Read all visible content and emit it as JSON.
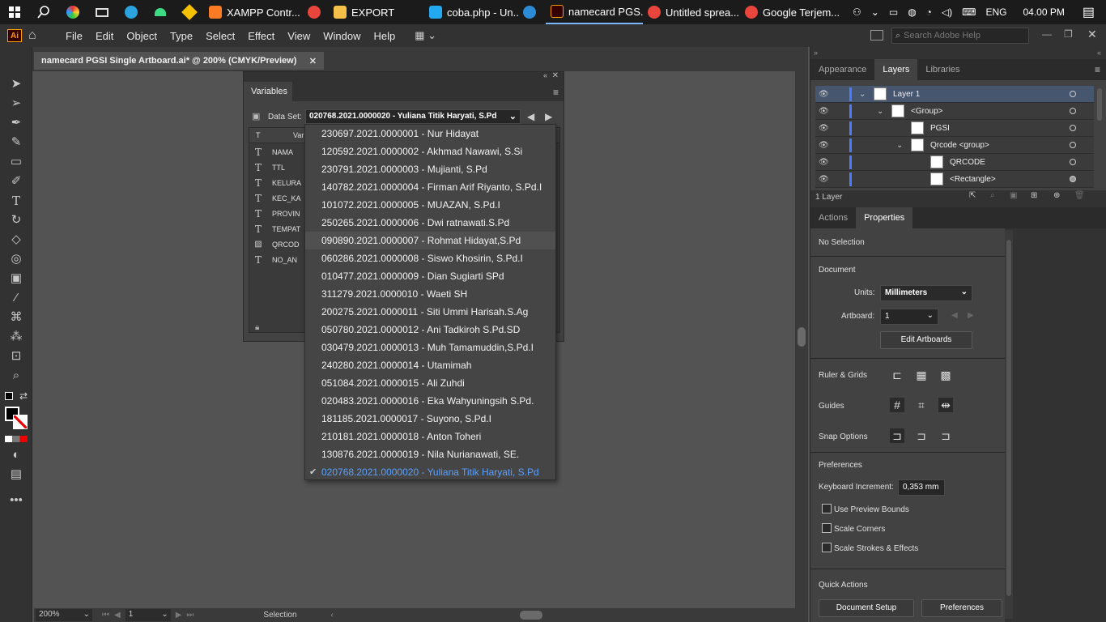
{
  "taskbar": {
    "apps": [
      {
        "label": "XAMPP Contr...",
        "color": "#fb7a24"
      },
      {
        "label": "",
        "color": "#e8453c"
      },
      {
        "label": "EXPORT",
        "color": "#f5c04a"
      },
      {
        "label": "coba.php - Un...",
        "color": "#23a9f2"
      },
      {
        "label": "",
        "color": "#2b8bd6"
      },
      {
        "label": "namecard PGS...",
        "color": "#ff9a00"
      },
      {
        "label": "Untitled sprea...",
        "color": "#e8453c"
      },
      {
        "label": "Google Terjem...",
        "color": "#e8453c"
      }
    ],
    "lang": "ENG",
    "time": "04.00 PM"
  },
  "menubar": {
    "logo": "Ai",
    "items": [
      "File",
      "Edit",
      "Object",
      "Type",
      "Select",
      "Effect",
      "View",
      "Window",
      "Help"
    ],
    "search_placeholder": "Search Adobe Help"
  },
  "document": {
    "tab_title": "namecard PGSI Single Artboard.ai* @ 200% (CMYK/Preview)",
    "zoom": "200%",
    "artboard_num": "1",
    "status": "Selection"
  },
  "variables_panel": {
    "title": "Variables",
    "dataset_label": "Data Set:",
    "dataset_value": "020768.2021.0000020 - Yuliana Titik Haryati, S.Pd",
    "columns": [
      "T",
      "Var"
    ],
    "variables": [
      {
        "type": "T",
        "name": "NAMA"
      },
      {
        "type": "T",
        "name": "TTL"
      },
      {
        "type": "T",
        "name": "KELURA"
      },
      {
        "type": "T",
        "name": "KEC_KA"
      },
      {
        "type": "T",
        "name": "PROVIN"
      },
      {
        "type": "T",
        "name": "TEMPAT"
      },
      {
        "type": "img",
        "name": "QRCOD"
      },
      {
        "type": "T",
        "name": "NO_AN"
      }
    ]
  },
  "dropdown": {
    "items": [
      "230697.2021.0000001 - Nur Hidayat",
      "120592.2021.0000002 - Akhmad Nawawi, S.Si",
      "230791.2021.0000003 - Mujianti, S.Pd",
      "140782.2021.0000004 - Firman Arif Riyanto, S.Pd.I",
      "101072.2021.0000005 - MUAZAN, S.Pd.I",
      "250265.2021.0000006 - Dwi ratnawati.S.Pd",
      "090890.2021.0000007 - Rohmat Hidayat,S.Pd",
      "060286.2021.0000008 - Siswo Khosirin, S.Pd.I",
      "010477.2021.0000009 - Dian Sugiarti SPd",
      "311279.2021.0000010 - Waeti SH",
      "200275.2021.0000011 - Siti Ummi Harisah.S.Ag",
      "050780.2021.0000012 - Ani Tadkiroh S.Pd.SD",
      "030479.2021.0000013 - Muh Tamamuddin,S.Pd.I",
      "240280.2021.0000014 - Utamimah",
      "051084.2021.0000015 - Ali Zuhdi",
      "020483.2021.0000016 - Eka Wahyuningsih S.Pd.",
      "181185.2021.0000017 - Suyono, S.Pd.I",
      "210181.2021.0000018 - Anton Toheri",
      "130876.2021.0000019 - Nila Nurianawati, SE.",
      "020768.2021.0000020 - Yuliana Titik Haryati, S.Pd"
    ],
    "hover_index": 6,
    "selected_index": 19,
    "check": "✔"
  },
  "layers_panel": {
    "tabs": [
      "Appearance",
      "Layers",
      "Libraries"
    ],
    "active_tab": "Layers",
    "rows": [
      {
        "name": "Layer 1",
        "indent": 0,
        "expanded": true
      },
      {
        "name": "<Group>",
        "indent": 1,
        "expanded": true
      },
      {
        "name": "PGSI",
        "indent": 2,
        "expanded": false
      },
      {
        "name": "Qrcode <group>",
        "indent": 2,
        "expanded": true
      },
      {
        "name": "QRCODE",
        "indent": 3,
        "expanded": false
      },
      {
        "name": "<Rectangle>",
        "indent": 3,
        "expanded": false
      }
    ],
    "count": "1 Layer"
  },
  "properties_panel": {
    "tabs": [
      "Actions",
      "Properties"
    ],
    "active_tab": "Properties",
    "selection": "No Selection",
    "document_label": "Document",
    "units_label": "Units:",
    "units_value": "Millimeters",
    "artboard_label": "Artboard:",
    "artboard_value": "1",
    "edit_artboards": "Edit Artboards",
    "ruler_grids": "Ruler & Grids",
    "guides": "Guides",
    "snap_options": "Snap Options",
    "preferences": "Preferences",
    "keyboard_increment_label": "Keyboard Increment:",
    "keyboard_increment_value": "0,353 mm",
    "checkboxes": [
      "Use Preview Bounds",
      "Scale Corners",
      "Scale Strokes & Effects"
    ],
    "quick_actions": "Quick Actions",
    "document_setup": "Document Setup",
    "preferences_btn": "Preferences"
  }
}
